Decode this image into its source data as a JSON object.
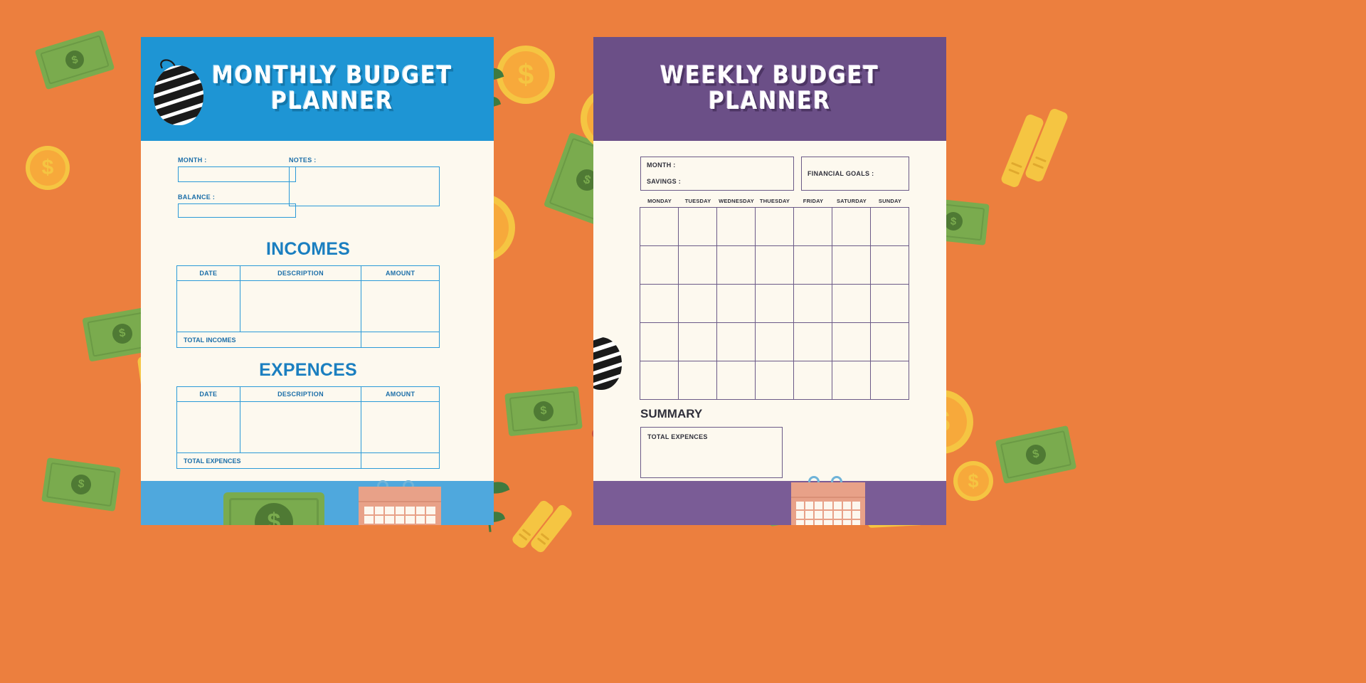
{
  "background": {
    "color": "#ec7f3e"
  },
  "pages": [
    {
      "id": "monthly",
      "title_line1": "MONTHLY BUDGET",
      "title_line2": "PLANNER",
      "accent": "#1e95d4",
      "paper": "#fdf9ef",
      "fields": [
        {
          "label": "MONTH :",
          "value": ""
        },
        {
          "label": "BALANCE :",
          "value": ""
        },
        {
          "label": "NOTES :",
          "value": ""
        }
      ],
      "sections": [
        {
          "heading": "INCOMES",
          "columns": [
            "DATE",
            "DESCRIPTION",
            "AMOUNT"
          ],
          "rows": [
            [
              "",
              "",
              ""
            ]
          ],
          "total_label": "TOTAL INCOMES",
          "total_value": ""
        },
        {
          "heading": "EXPENCES",
          "columns": [
            "DATE",
            "DESCRIPTION",
            "AMOUNT"
          ],
          "rows": [
            [
              "",
              "",
              ""
            ]
          ],
          "total_label": "TOTAL EXPENCES",
          "total_value": ""
        }
      ]
    },
    {
      "id": "weekly",
      "title_line1": "WEEKLY BUDGET",
      "title_line2": "PLANNER",
      "accent": "#6b4f87",
      "paper": "#fdf9ef",
      "fields": [
        {
          "label": "MONTH :",
          "value": ""
        },
        {
          "label": "SAVINGS :",
          "value": ""
        },
        {
          "label": "FINANCIAL GOALS :",
          "value": ""
        }
      ],
      "weekdays": [
        "MONDAY",
        "TUESDAY",
        "WEDNESDAY",
        "THUESDAY",
        "FRIDAY",
        "SATURDAY",
        "SUNDAY"
      ],
      "calendar_rows": 5,
      "summary": {
        "heading": "SUMMARY",
        "total_label": "TOTAL EXPENCES",
        "total_value": ""
      }
    }
  ],
  "decorations": {
    "dollar_sign": "$",
    "items": [
      "coin",
      "banknote",
      "balloon",
      "leaf-plant",
      "berry-branch",
      "gold-bar",
      "calendar"
    ]
  }
}
